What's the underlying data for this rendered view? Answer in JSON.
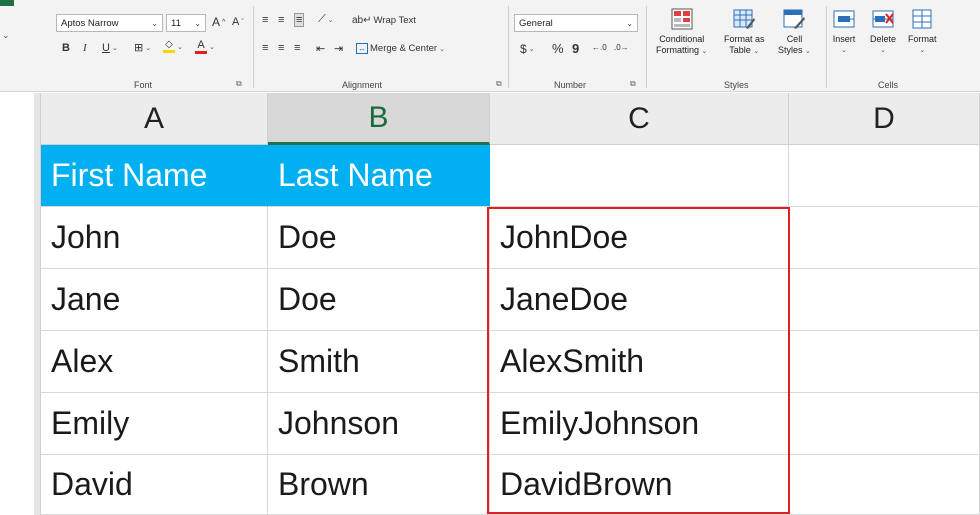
{
  "ribbon": {
    "font": {
      "name": "Aptos Narrow",
      "size": "11",
      "grow": "A",
      "shrink": "A",
      "bold": "B",
      "italic": "I",
      "underline": "U",
      "font_color": "A",
      "label": "Font"
    },
    "alignment": {
      "wrap_text": "Wrap Text",
      "merge_center": "Merge & Center",
      "label": "Alignment"
    },
    "number": {
      "format": "General",
      "currency": "$",
      "percent": "%",
      "comma": "9",
      "label": "Number"
    },
    "styles": {
      "conditional": [
        "Conditional",
        "Formatting"
      ],
      "format_table": [
        "Format as",
        "Table"
      ],
      "cell_styles": [
        "Cell",
        "Styles"
      ],
      "label": "Styles"
    },
    "cells": {
      "insert": "Insert",
      "delete": "Delete",
      "format": "Format",
      "label": "Cells"
    }
  },
  "sheet": {
    "columns": [
      "A",
      "B",
      "C",
      "D"
    ],
    "selected_column": "B",
    "header_row": [
      "First Name",
      "Last Name",
      ""
    ],
    "rows": [
      [
        "John",
        "Doe",
        "JohnDoe"
      ],
      [
        "Jane",
        "Doe",
        "JaneDoe"
      ],
      [
        "Alex",
        "Smith",
        "AlexSmith"
      ],
      [
        "Emily",
        "Johnson",
        "EmilyJohnson"
      ],
      [
        "David",
        "Brown",
        "DavidBrown"
      ]
    ],
    "colors": {
      "header_fill": "#00b0f0",
      "header_text": "#ffffff",
      "highlight_border": "#e02020",
      "selected_column_accent": "#217346"
    }
  }
}
